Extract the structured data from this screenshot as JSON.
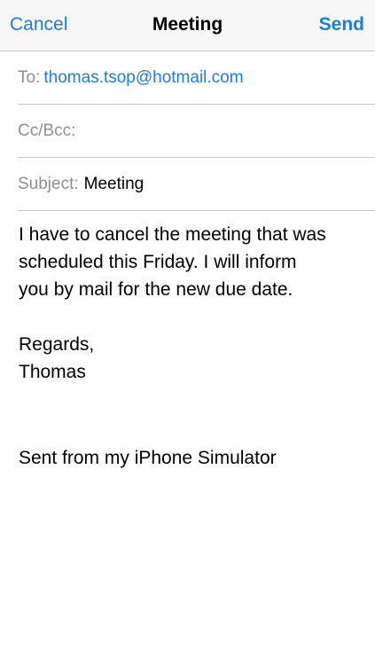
{
  "navbar": {
    "cancel_label": "Cancel",
    "title": "Meeting",
    "send_label": "Send"
  },
  "fields": {
    "to_label": "To:",
    "to_value": "thomas.tsop@hotmail.com",
    "cc_label": "Cc/Bcc:",
    "subject_label": "Subject:",
    "subject_value": "Meeting"
  },
  "body": {
    "lines": [
      "I have to cancel the meeting that was",
      "scheduled this Friday. I will inform",
      "you by mail for the new due date."
    ],
    "closing": "Regards,",
    "name": "Thomas",
    "signature": "Sent from my iPhone Simulator"
  },
  "colors": {
    "accent": "#1a7ee0",
    "label_gray": "#8e8e93",
    "separator": "#c8c7cc"
  }
}
